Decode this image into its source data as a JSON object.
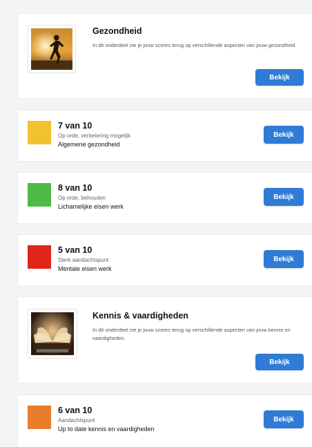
{
  "health": {
    "title": "Gezondheid",
    "description": "In dit onderdeel zie je jouw scores terug op verschillende aspecten van jouw gezondheid.",
    "button": "Bekijk",
    "image_icon": "runner-sunset-photo"
  },
  "score_items": [
    {
      "score": "7 van 10",
      "status": "Op orde, verbetering mogelijk",
      "label": "Algemene gezondheid",
      "color": "#f2c12e",
      "button": "Bekijk"
    },
    {
      "score": "8 van 10",
      "status": "Op orde, behouden",
      "label": "Lichamelijke eisen werk",
      "color": "#4cbb47",
      "button": "Bekijk"
    },
    {
      "score": "5 van 10",
      "status": "Sterk aandachtspunt",
      "label": "Mentale eisen werk",
      "color": "#e0261b",
      "button": "Bekijk"
    }
  ],
  "knowledge": {
    "title": "Kennis & vaardigheden",
    "description": "In dit onderdeel zie je jouw scores terug op verschillende aspecten van jouw kennis en vaardigheden.",
    "button": "Bekijk",
    "image_icon": "open-book-photo"
  },
  "knowledge_item": {
    "score": "6 van 10",
    "status": "Aandachtspunt",
    "label": "Up to date kennis en vaardigheden",
    "color": "#ea7d2c",
    "button": "Bekijk"
  },
  "colors": {
    "button": "#2f7bd6",
    "background": "#f3f4f6"
  }
}
